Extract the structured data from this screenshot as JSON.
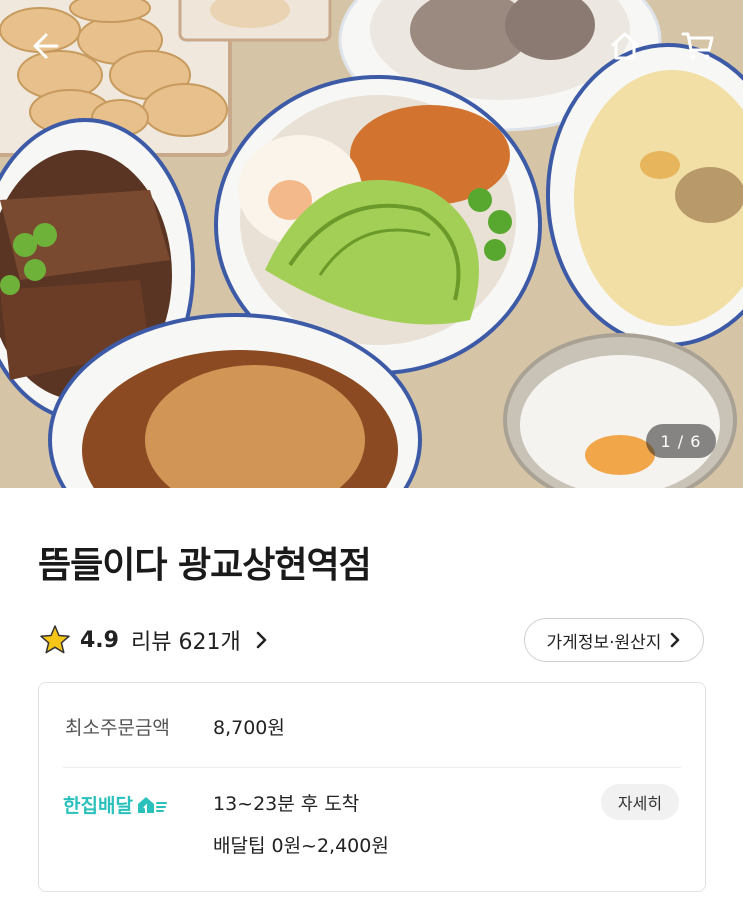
{
  "header": {
    "back_icon": "back-arrow-icon",
    "home_icon": "home-icon",
    "cart_icon": "cart-icon",
    "image_counter": "1 / 6"
  },
  "store": {
    "name": "뜸들이다 광교상현역점",
    "rating": "4.9",
    "reviews_label": "리뷰 621개",
    "info_button": "가게정보·원산지"
  },
  "delivery_card": {
    "min_order_label": "최소주문금액",
    "min_order_value": "8,700원",
    "service_name": "한집배달",
    "eta": "13~23분 후 도착",
    "tip": "배달팁 0원~2,400원",
    "detail_button": "자세히"
  },
  "colors": {
    "accent": "#2ac1bc",
    "star": "#f5c518",
    "food_bg": "#d8c6a9"
  }
}
